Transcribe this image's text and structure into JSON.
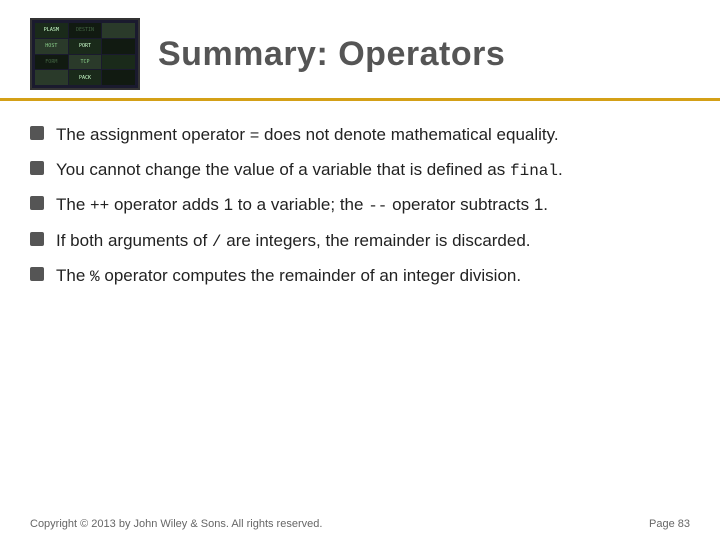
{
  "header": {
    "title": "Summary: Operators"
  },
  "bullets": [
    {
      "id": 1,
      "text": "The assignment operator = does not denote mathematical equality."
    },
    {
      "id": 2,
      "text": "You cannot change the value of a variable that is defined as final.",
      "hasCode": true,
      "codePart": "final"
    },
    {
      "id": 3,
      "text": "The ++ operator adds 1 to a variable; the -- operator subtracts 1.",
      "hasCode": true,
      "codeParts": [
        "++",
        "--"
      ]
    },
    {
      "id": 4,
      "text": "If both arguments of / are integers, the remainder is discarded."
    },
    {
      "id": 5,
      "text": "The % operator computes the remainder of an integer division."
    }
  ],
  "footer": {
    "copyright": "Copyright © 2013 by John Wiley & Sons.  All rights reserved.",
    "page": "Page 83"
  },
  "colors": {
    "gold": "#d4a017",
    "text": "#222222",
    "header_text": "#555555",
    "bullet_marker": "#555555"
  }
}
